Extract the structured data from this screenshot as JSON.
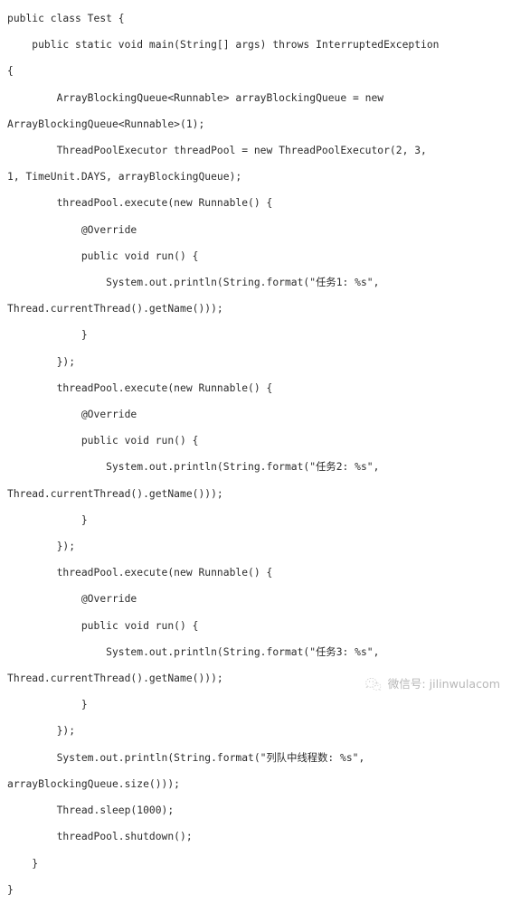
{
  "document": {
    "type": "java-source-code",
    "language": "Java",
    "class_name": "Test",
    "background_color": "#ffffff",
    "text_color": "#2b2b2b"
  },
  "code": {
    "lines": [
      {
        "text": "public class Test {",
        "wrapped": false
      },
      {
        "text": "    public static void main(String[] args) throws InterruptedException",
        "wrapped": false
      },
      {
        "text": "{",
        "wrapped": true
      },
      {
        "text": "        ArrayBlockingQueue<Runnable> arrayBlockingQueue = new",
        "wrapped": false
      },
      {
        "text": "ArrayBlockingQueue<Runnable>(1);",
        "wrapped": true
      },
      {
        "text": "        ThreadPoolExecutor threadPool = new ThreadPoolExecutor(2, 3,",
        "wrapped": false
      },
      {
        "text": "1, TimeUnit.DAYS, arrayBlockingQueue);",
        "wrapped": true
      },
      {
        "text": "        threadPool.execute(new Runnable() {",
        "wrapped": false
      },
      {
        "text": "            @Override",
        "wrapped": false
      },
      {
        "text": "            public void run() {",
        "wrapped": false
      },
      {
        "text": "                System.out.println(String.format(\"任务1: %s\",",
        "wrapped": false
      },
      {
        "text": "Thread.currentThread().getName()));",
        "wrapped": true
      },
      {
        "text": "            }",
        "wrapped": false
      },
      {
        "text": "        });",
        "wrapped": false
      },
      {
        "text": "        threadPool.execute(new Runnable() {",
        "wrapped": false
      },
      {
        "text": "            @Override",
        "wrapped": false
      },
      {
        "text": "            public void run() {",
        "wrapped": false
      },
      {
        "text": "                System.out.println(String.format(\"任务2: %s\",",
        "wrapped": false
      },
      {
        "text": "Thread.currentThread().getName()));",
        "wrapped": true
      },
      {
        "text": "            }",
        "wrapped": false
      },
      {
        "text": "        });",
        "wrapped": false
      },
      {
        "text": "        threadPool.execute(new Runnable() {",
        "wrapped": false
      },
      {
        "text": "            @Override",
        "wrapped": false
      },
      {
        "text": "            public void run() {",
        "wrapped": false
      },
      {
        "text": "                System.out.println(String.format(\"任务3: %s\",",
        "wrapped": false
      },
      {
        "text": "Thread.currentThread().getName()));",
        "wrapped": true
      },
      {
        "text": "            }",
        "wrapped": false
      },
      {
        "text": "        });",
        "wrapped": false
      },
      {
        "text": "        System.out.println(String.format(\"列队中线程数: %s\",",
        "wrapped": false
      },
      {
        "text": "arrayBlockingQueue.size()));",
        "wrapped": true
      },
      {
        "text": "        Thread.sleep(1000);",
        "wrapped": false
      },
      {
        "text": "        threadPool.shutdown();",
        "wrapped": false
      },
      {
        "text": "    }",
        "wrapped": false
      },
      {
        "text": "}",
        "wrapped": false
      }
    ]
  },
  "watermark": {
    "icon": "wechat-icon",
    "text": "微信号: jilinwulacom",
    "color": "#8c8c8c"
  }
}
